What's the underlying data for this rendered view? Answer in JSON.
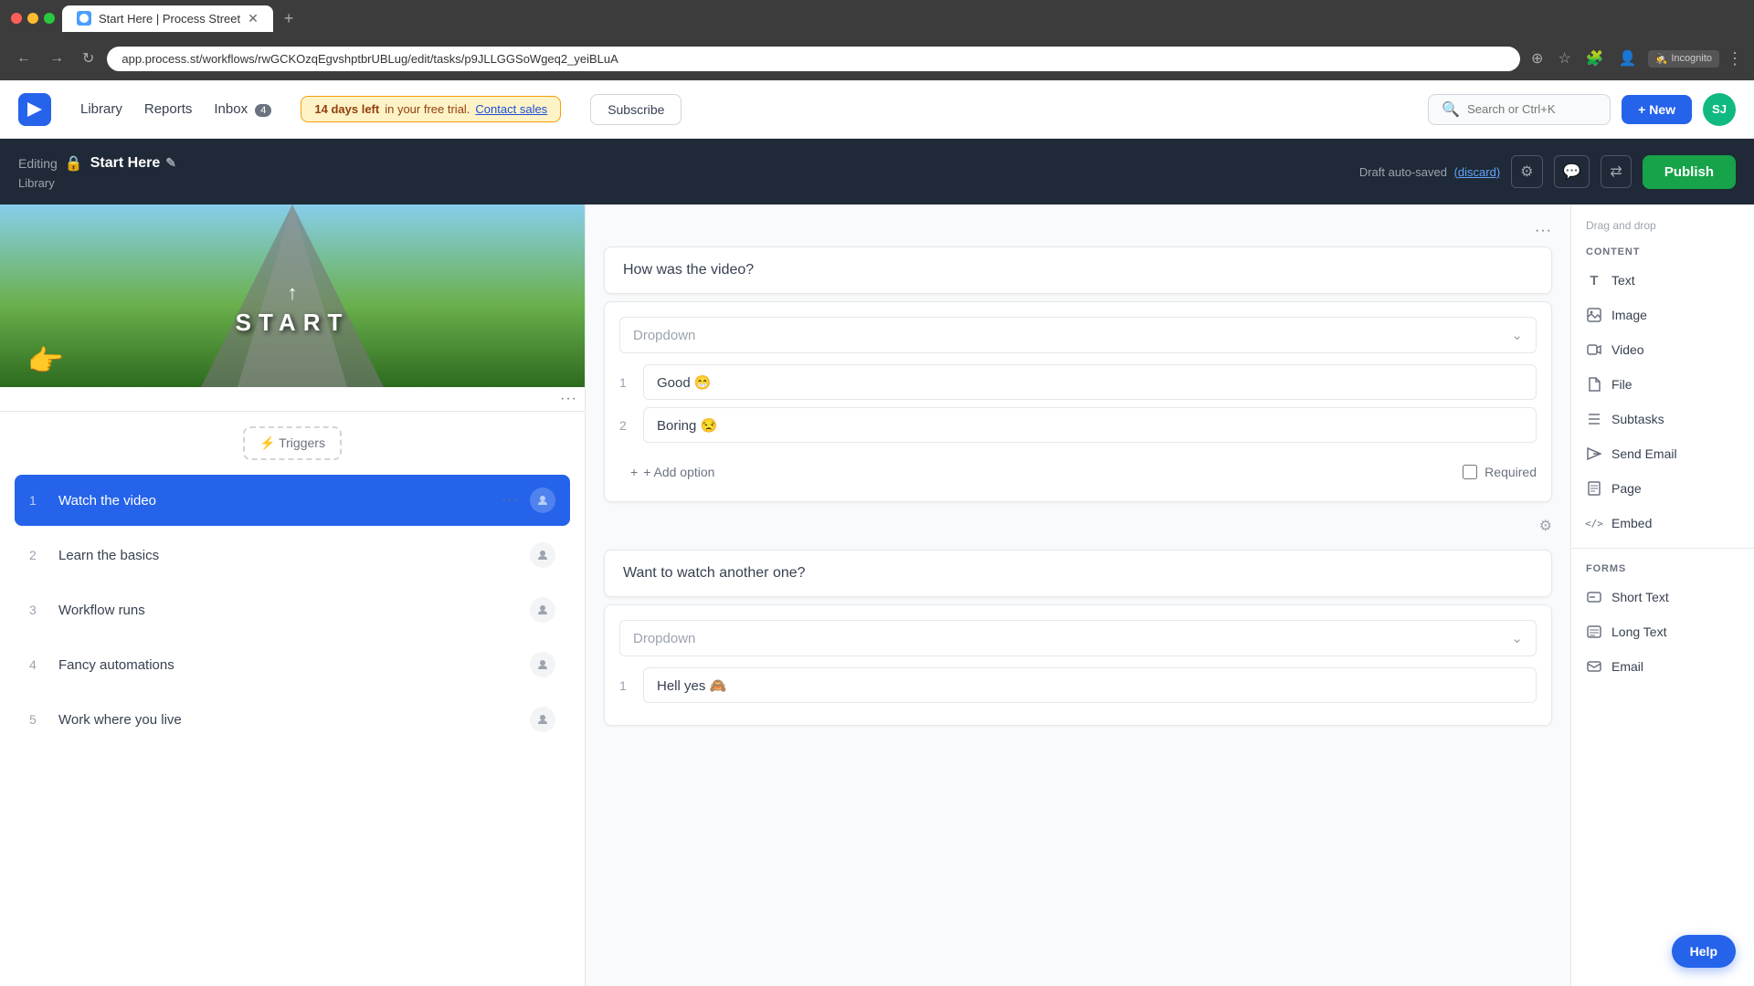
{
  "browser": {
    "tab_title": "Start Here | Process Street",
    "url": "app.process.st/workflows/rwGCKOzqEgvshptbrUBLug/edit/tasks/p9JLLGGSoWgeq2_yeiBLuA",
    "new_tab_icon": "+",
    "incognito_label": "Incognito"
  },
  "app_header": {
    "nav": {
      "library": "Library",
      "reports": "Reports",
      "inbox": "Inbox",
      "inbox_count": "4"
    },
    "trial_banner": {
      "days_left": "14 days left",
      "message": " in your free trial.",
      "contact_sales": "Contact sales"
    },
    "subscribe_label": "Subscribe",
    "search_placeholder": "Search or Ctrl+K",
    "new_label": "+ New"
  },
  "sub_header": {
    "editing_label": "Editing",
    "workflow_name": "Start Here",
    "library_label": "Library",
    "draft_status": "Draft auto-saved",
    "discard_label": "(discard)",
    "publish_label": "Publish"
  },
  "left_panel": {
    "triggers_label": "⚡ Triggers",
    "tasks": [
      {
        "number": "1",
        "name": "Watch the video",
        "active": true
      },
      {
        "number": "2",
        "name": "Learn the basics",
        "active": false
      },
      {
        "number": "3",
        "name": "Workflow runs",
        "active": false
      },
      {
        "number": "4",
        "name": "Fancy automations",
        "active": false
      },
      {
        "number": "5",
        "name": "Work where you live",
        "active": false
      }
    ]
  },
  "center_panel": {
    "three_dots": "···",
    "form1": {
      "title": "How was the video?",
      "dropdown_placeholder": "Dropdown",
      "options": [
        {
          "number": "1",
          "value": "Good 😁"
        },
        {
          "number": "2",
          "value": "Boring 😒"
        }
      ],
      "add_option_label": "+ Add option",
      "required_label": "Required"
    },
    "form2": {
      "title": "Want to watch another one?",
      "dropdown_placeholder": "Dropdown",
      "options": [
        {
          "number": "1",
          "value": "Hell yes 🙈"
        }
      ]
    }
  },
  "right_panel": {
    "drag_drop_label": "Drag and drop",
    "content_section": "CONTENT",
    "content_items": [
      {
        "icon": "T",
        "label": "Text",
        "icon_name": "text-icon"
      },
      {
        "icon": "🖼",
        "label": "Image",
        "icon_name": "image-icon"
      },
      {
        "icon": "▶",
        "label": "Video",
        "icon_name": "video-icon"
      },
      {
        "icon": "📄",
        "label": "File",
        "icon_name": "file-icon"
      },
      {
        "icon": "☰",
        "label": "Subtasks",
        "icon_name": "subtasks-icon"
      },
      {
        "icon": "✉",
        "label": "Send Email",
        "icon_name": "send-email-icon"
      },
      {
        "icon": "📃",
        "label": "Page",
        "icon_name": "page-icon"
      },
      {
        "icon": "</>",
        "label": "Embed",
        "icon_name": "embed-icon"
      }
    ],
    "forms_section": "FORMS",
    "forms_items": [
      {
        "icon": "A",
        "label": "Short Text",
        "icon_name": "short-text-icon"
      },
      {
        "icon": "¶",
        "label": "Long Text",
        "icon_name": "long-text-icon"
      },
      {
        "icon": "✉",
        "label": "Email",
        "icon_name": "email-icon"
      }
    ]
  },
  "help_label": "Help"
}
